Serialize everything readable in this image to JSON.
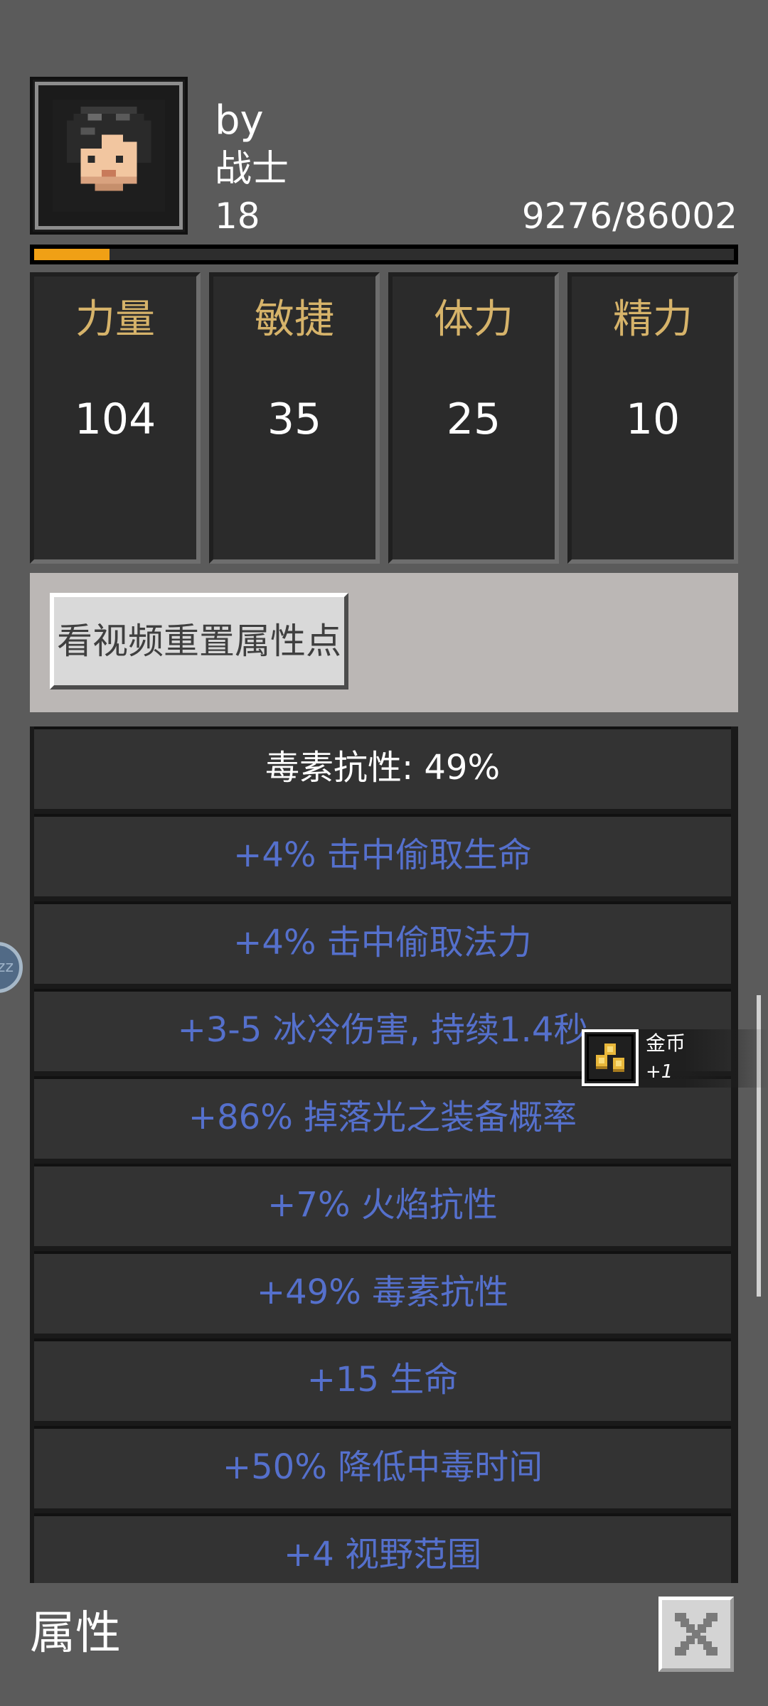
{
  "player": {
    "name": "by",
    "class": "战士",
    "level": "18",
    "xp_text": "9276/86002",
    "xp_fraction": 0.108
  },
  "stats": [
    {
      "label": "力量",
      "value": "104"
    },
    {
      "label": "敏捷",
      "value": "35"
    },
    {
      "label": "体力",
      "value": "25"
    },
    {
      "label": "精力",
      "value": "10"
    }
  ],
  "reset_button_label": "看视频重置属性点",
  "attributes": {
    "header": "毒素抗性: 49%",
    "items": [
      "+4% 击中偷取生命",
      "+4% 击中偷取法力",
      "+3-5 冰冷伤害, 持续1.4秒",
      "+86% 掉落光之装备概率",
      "+7% 火焰抗性",
      "+49% 毒素抗性",
      "+15 生命",
      "+50% 降低中毒时间",
      "+4 视野范围"
    ]
  },
  "toast": {
    "title": "金币",
    "amount": "+1",
    "icon": "gold-coins-icon"
  },
  "side_bubble": {
    "text": "zz"
  },
  "footer": {
    "title": "属性",
    "close_icon": "close-x-icon"
  },
  "colors": {
    "background": "#5b5b5b",
    "xp_fill": "#f0a015",
    "stat_label": "#d6b36a",
    "attribute_text": "#5570cc"
  }
}
